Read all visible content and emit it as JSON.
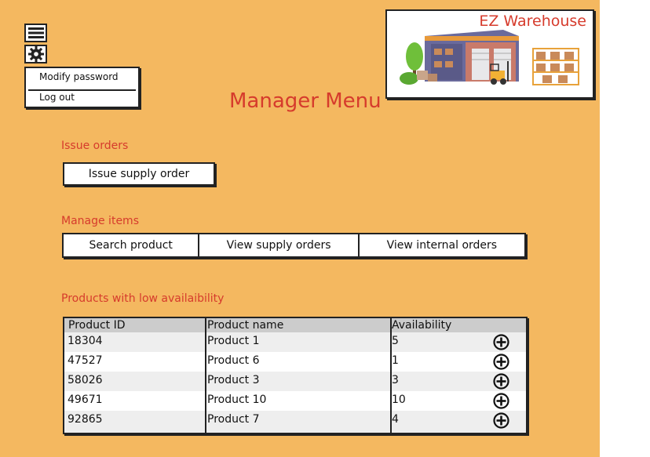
{
  "app": {
    "logo_text": "EZ Warehouse",
    "page_title": "Manager Menu"
  },
  "icons": {
    "menu": "hamburger-menu-icon",
    "settings": "gear-icon",
    "add": "plus-circle-icon"
  },
  "user_menu": {
    "modify_password": "Modify password",
    "log_out": "Log out"
  },
  "sections": {
    "issue_orders": {
      "label": "Issue orders",
      "button": "Issue supply order"
    },
    "manage_items": {
      "label": "Manage items",
      "buttons": [
        "Search product",
        "View supply orders",
        "View internal orders"
      ]
    },
    "low_availability": {
      "label": "Products with low availaibility",
      "columns": [
        "Product ID",
        "Product name",
        "Availability"
      ],
      "rows": [
        {
          "id": "18304",
          "name": "Product 1",
          "availability": "5"
        },
        {
          "id": "47527",
          "name": "Product 6",
          "availability": "1"
        },
        {
          "id": "58026",
          "name": "Product 3",
          "availability": "3"
        },
        {
          "id": "49671",
          "name": "Product 10",
          "availability": "10"
        },
        {
          "id": "92865",
          "name": "Product 7",
          "availability": "4"
        }
      ]
    }
  },
  "colors": {
    "background": "#f4b860",
    "accent": "#d63b2c",
    "table_header": "#cccccc",
    "table_row_alt": "#ffffff",
    "table_row": "#eeeeee"
  }
}
